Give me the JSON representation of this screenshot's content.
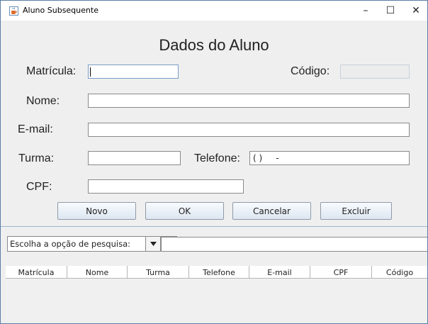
{
  "window": {
    "title": "Aluno Subsequente",
    "controls": {
      "minimize": "–",
      "maximize": "☐",
      "close": "✕"
    }
  },
  "form": {
    "heading": "Dados do Aluno",
    "matricula_label": "Matrícula:",
    "matricula_value": "",
    "codigo_label": "Código:",
    "codigo_value": "",
    "nome_label": "Nome:",
    "nome_value": "",
    "email_label": "E-mail:",
    "email_value": "",
    "turma_label": "Turma:",
    "turma_value": "",
    "telefone_label": "Telefone:",
    "telefone_mask": "( )     -",
    "cpf_label": "CPF:",
    "cpf_value": ""
  },
  "buttons": {
    "novo": "Novo",
    "ok": "OK",
    "cancelar": "Cancelar",
    "excluir": "Excluir"
  },
  "search": {
    "option_selected": "Escolha a opção de pesquisa:",
    "query": ""
  },
  "table": {
    "columns": [
      "Matrícula",
      "Nome",
      "Turma",
      "Telefone",
      "E-mail",
      "CPF",
      "Código"
    ],
    "rows": []
  },
  "colors": {
    "window_border": "#5a7ea6",
    "background": "#efefef",
    "button_gradient_top": "#f8fbff",
    "button_gradient_bottom": "#dde6f0"
  }
}
